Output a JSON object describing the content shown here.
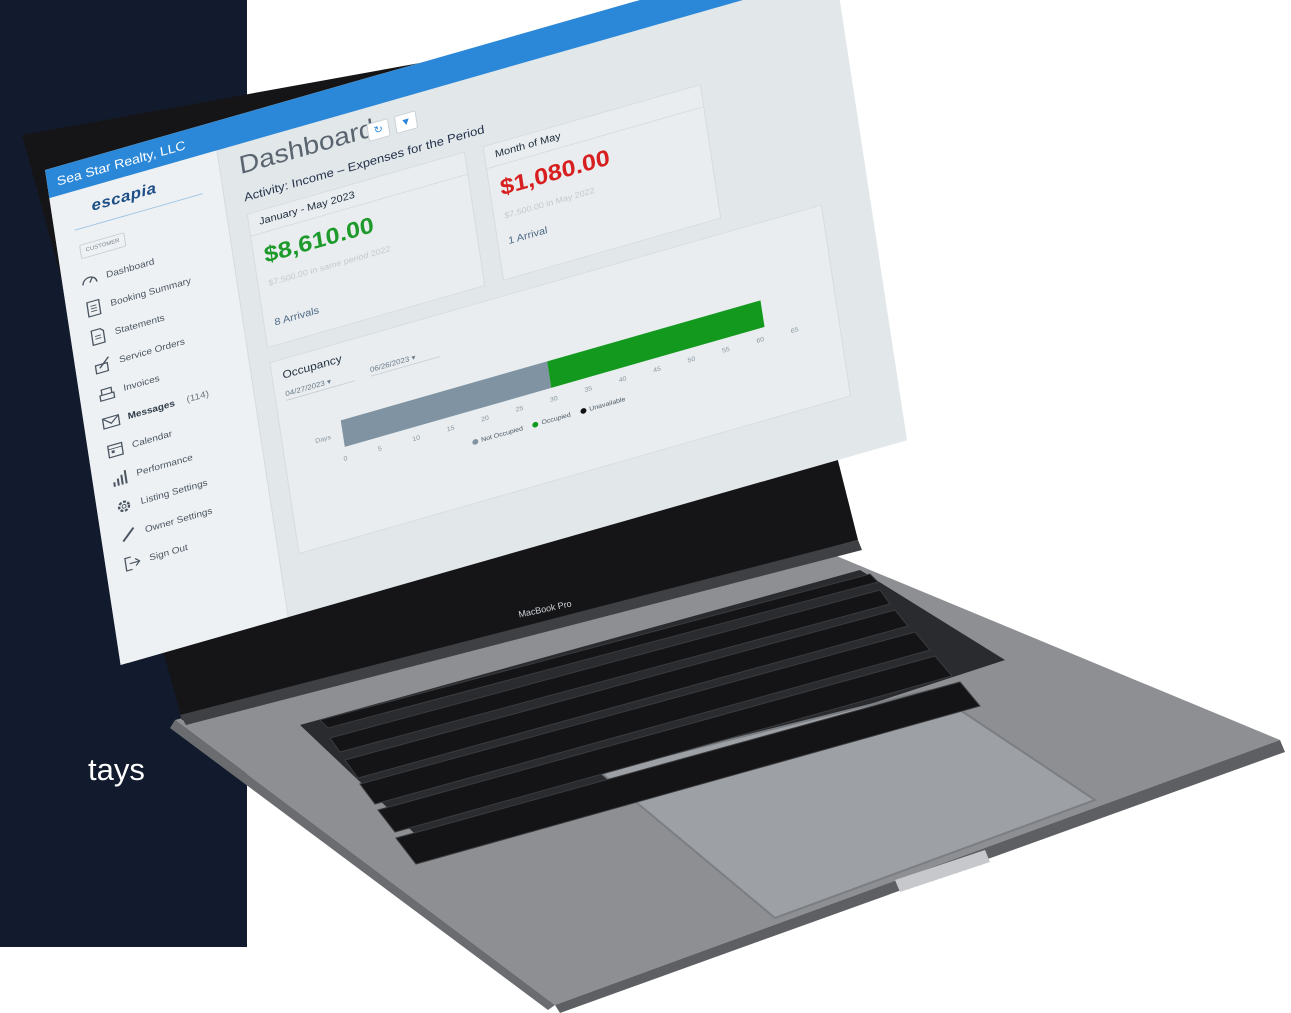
{
  "side_panel": {
    "text": "tays"
  },
  "window": {
    "org_name": "Sea Star Realty, LLC"
  },
  "sidebar": {
    "logo_text": "escapia",
    "customer_badge": "CUSTOMER",
    "items": [
      {
        "label": "Dashboard",
        "icon": "gauge-icon"
      },
      {
        "label": "Booking Summary",
        "icon": "document-icon"
      },
      {
        "label": "Statements",
        "icon": "statement-icon"
      },
      {
        "label": "Service Orders",
        "icon": "pen-paper-icon"
      },
      {
        "label": "Invoices",
        "icon": "invoice-tray-icon"
      },
      {
        "label": "Messages",
        "icon": "envelope-icon",
        "count": "(114)"
      },
      {
        "label": "Calendar",
        "icon": "calendar-icon"
      },
      {
        "label": "Performance",
        "icon": "bar-chart-icon"
      },
      {
        "label": "Listing Settings",
        "icon": "gear-icon"
      },
      {
        "label": "Owner Settings",
        "icon": "pencil-icon"
      },
      {
        "label": "Sign Out",
        "icon": "sign-out-icon"
      }
    ]
  },
  "main": {
    "title": "Dashboard",
    "refresh_icon": "refresh-icon",
    "filter_icon": "filter-icon",
    "activity_title": "Activity: Income – Expenses for the Period",
    "ytd_card": {
      "header": "January - May 2023",
      "amount": "$8,610.00",
      "compare": "$7,500.00 in same period 2022",
      "arrivals": "8 Arrivals"
    },
    "month_card": {
      "header": "Month of May",
      "amount": "$1,080.00",
      "compare": "$7,500.00 in May 2022",
      "arrivals": "1 Arrival"
    },
    "occupancy": {
      "title": "Occupancy",
      "start_date": "04/27/2023",
      "end_date": "06/26/2023",
      "row_label": "Days",
      "legend": [
        {
          "label": "Not Occupied",
          "color": "#7f93a2"
        },
        {
          "label": "Occupied",
          "color": "#13991e"
        },
        {
          "label": "Unavailable",
          "color": "#111111"
        }
      ]
    }
  },
  "chart_data": {
    "type": "bar",
    "title": "Occupancy",
    "categories": [
      "Days"
    ],
    "series": [
      {
        "name": "Not Occupied",
        "values": [
          30
        ]
      },
      {
        "name": "Occupied",
        "values": [
          31
        ]
      },
      {
        "name": "Unavailable",
        "values": [
          0
        ]
      }
    ],
    "stacked": true,
    "orientation": "horizontal",
    "xlim": [
      0,
      65
    ],
    "x_ticks": [
      "0",
      "5",
      "10",
      "15",
      "20",
      "25",
      "30",
      "35",
      "40",
      "45",
      "50",
      "55",
      "60",
      "65"
    ],
    "legend_position": "bottom"
  },
  "device": {
    "brand_label": "MacBook Pro"
  }
}
